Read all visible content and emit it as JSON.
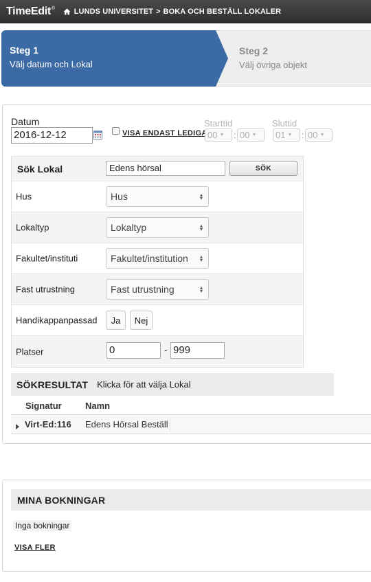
{
  "app": {
    "logo": "TimeEdit",
    "logo_mark": "®"
  },
  "breadcrumb": {
    "item1": "LUNDS UNIVERSITET",
    "separator": ">",
    "item2": "BOKA OCH BESTÄLL LOKALER"
  },
  "steps": [
    {
      "title": "Steg 1",
      "subtitle": "Välj datum och Lokal",
      "active": true
    },
    {
      "title": "Steg 2",
      "subtitle": "Välj övriga objekt",
      "active": false
    }
  ],
  "date": {
    "label": "Datum",
    "value": "2016-12-12"
  },
  "only_free": {
    "label": "VISA ENDAST LEDIGA",
    "checked": false
  },
  "time": {
    "start_label": "Starttid",
    "start_hour": "00",
    "start_min": "00",
    "end_label": "Sluttid",
    "end_hour": "01",
    "end_min": "00",
    "separator": ":"
  },
  "search": {
    "label": "Sök Lokal",
    "value": "Edens hörsal",
    "button": "SÖK",
    "fields": [
      {
        "label": "Hus",
        "selected": "Hus"
      },
      {
        "label": "Lokaltyp",
        "selected": "Lokaltyp"
      },
      {
        "label": "Fakultet/instituti",
        "selected": "Fakultet/institution"
      },
      {
        "label": "Fast utrustning",
        "selected": "Fast utrustning"
      }
    ],
    "accessible": {
      "label": "Handikappanpassad",
      "yes": "Ja",
      "no": "Nej"
    },
    "seats": {
      "label": "Platser",
      "min": "0",
      "dash": "-",
      "max": "999"
    }
  },
  "results": {
    "title": "SÖKRESULTAT",
    "hint": "Klicka för att välja Lokal",
    "col_signature": "Signatur",
    "col_name": "Namn",
    "rows": [
      {
        "signature": "Virt-Ed:116",
        "name": "Edens Hörsal Beställ"
      }
    ]
  },
  "bookings": {
    "title": "MINA BOKNINGAR",
    "empty_text": "Inga bokningar",
    "more_link": "VISA FLER"
  },
  "colors": {
    "topbar": "#3a3a3a",
    "step_active": "#3b6aa5",
    "step_inactive": "#eeeeee",
    "panel_header": "#ebebeb"
  },
  "icons": [
    "home-icon",
    "calendar-icon",
    "expand-triangle-icon",
    "select-arrows-icon"
  ]
}
